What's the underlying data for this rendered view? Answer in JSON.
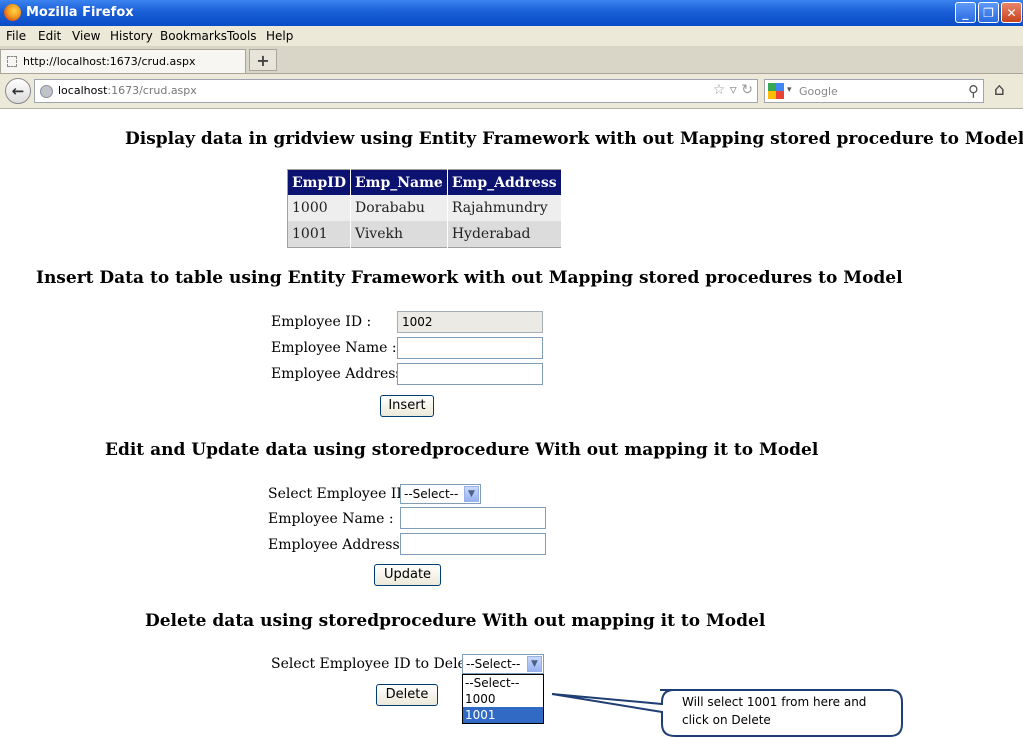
{
  "window": {
    "title": "Mozilla Firefox",
    "controls": {
      "minimize": "_",
      "maximize": "❐",
      "close": "✕"
    }
  },
  "menu": [
    "File",
    "Edit",
    "View",
    "History",
    "Bookmarks",
    "Tools",
    "Help"
  ],
  "tab": {
    "title": "http://localhost:1673/crud.aspx",
    "new_tab": "+"
  },
  "nav": {
    "url_host": "localhost",
    "url_path": ":1673/crud.aspx",
    "search_placeholder": "Google",
    "icons": {
      "back": "back-arrow-icon",
      "star": "star-icon",
      "reload": "reload-icon",
      "search": "magnifier-icon",
      "home": "home-icon"
    }
  },
  "display_section": {
    "heading": "Display data in gridview using Entity Framework with out Mapping stored procedure to Model",
    "columns": [
      "EmpID",
      "Emp_Name",
      "Emp_Address"
    ],
    "rows": [
      [
        "1000",
        "Dorababu",
        "Rajahmundry"
      ],
      [
        "1001",
        "Vivekh",
        "Hyderabad"
      ]
    ],
    "header_color": "#0c1270"
  },
  "insert_section": {
    "heading": "Insert Data to table using Entity Framework with out Mapping stored procedures to Model",
    "id_label": "Employee ID :",
    "id_value": "1002",
    "name_label": "Employee Name :",
    "name_value": "",
    "address_label": "Employee Address :",
    "address_value": "",
    "button": "Insert"
  },
  "update_section": {
    "heading": "Edit and Update data using storedprocedure With out mapping it to Model",
    "select_label": "Select Employee ID :",
    "select_value": "--Select--",
    "name_label": "Employee Name :",
    "address_label": "Employee Address :",
    "button": "Update"
  },
  "delete_section": {
    "heading": "Delete data using storedprocedure With out mapping it to Model",
    "select_label": "Select Employee ID to Delete :",
    "select_value": "--Select--",
    "options": [
      "--Select--",
      "1000",
      "1001"
    ],
    "highlighted_option": "1001",
    "button": "Delete"
  },
  "callout": {
    "line1": "Will select 1001 from here and",
    "line2": "click on Delete"
  }
}
